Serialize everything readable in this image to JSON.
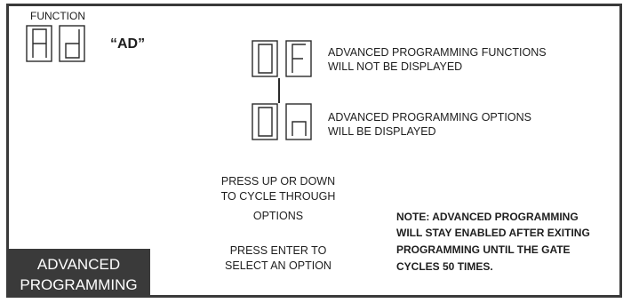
{
  "function_label": "FUNCTION",
  "function_code": "“AD”",
  "displays": {
    "function": [
      "A",
      "d"
    ],
    "option_off": [
      "O",
      "F"
    ],
    "option_on": [
      "O",
      "n"
    ]
  },
  "options": {
    "off": {
      "line1": "ADVANCED PROGRAMMING FUNCTIONS",
      "line2": "WILL NOT BE DISPLAYED"
    },
    "on": {
      "line1": "ADVANCED PROGRAMMING OPTIONS",
      "line2": "WILL BE DISPLAYED"
    }
  },
  "instructions": {
    "cycle": [
      "PRESS UP OR DOWN",
      "TO CYCLE THROUGH",
      "OPTIONS"
    ],
    "select": [
      "PRESS ENTER TO",
      "SELECT AN OPTION"
    ]
  },
  "note": [
    "NOTE: ADVANCED PROGRAMMING",
    "WILL STAY ENABLED AFTER EXITING",
    "PROGRAMMING UNTIL THE GATE",
    "CYCLES 50 TIMES."
  ],
  "badge": [
    "ADVANCED",
    "PROGRAMMING"
  ]
}
